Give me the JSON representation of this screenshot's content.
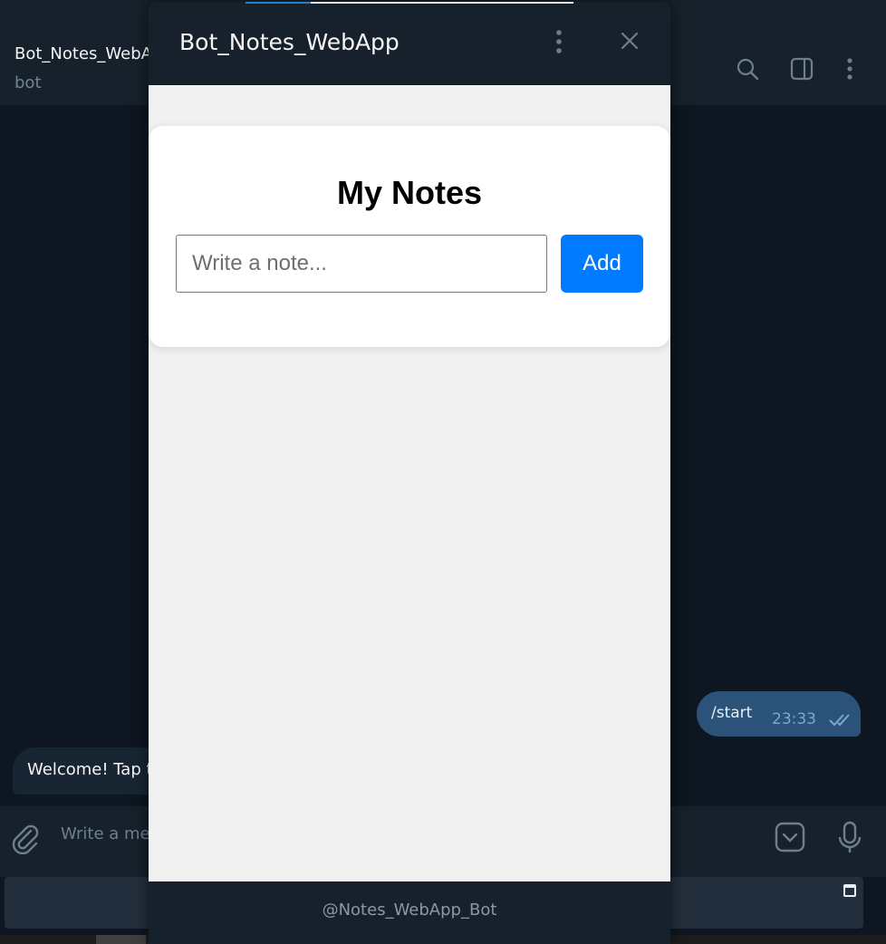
{
  "chat": {
    "name": "Bot_Notes_WebApp",
    "status": "bot"
  },
  "header_icons": [
    "search-icon",
    "sidebar-toggle-icon",
    "more-vertical-icon"
  ],
  "messages": {
    "outgoing": {
      "text": "/start",
      "time": "23:33",
      "status": "read"
    },
    "incoming": {
      "text": "Welcome! Tap t"
    }
  },
  "composer": {
    "placeholder": "Write a me",
    "icons": [
      "attach-icon",
      "bot-keyboard-icon",
      "microphone-icon"
    ]
  },
  "webapp": {
    "title": "Bot_Notes_WebApp",
    "footer": "@Notes_WebApp_Bot",
    "notes": {
      "heading": "My Notes",
      "input_placeholder": "Write a note...",
      "input_value": "",
      "add_label": "Add"
    }
  },
  "colors": {
    "chat_background": "#0e1621",
    "panel_header": "#17212b",
    "outgoing_bubble": "#2b5278",
    "incoming_bubble": "#182533",
    "webapp_background": "#f1f1f1",
    "add_button": "#007bff"
  }
}
